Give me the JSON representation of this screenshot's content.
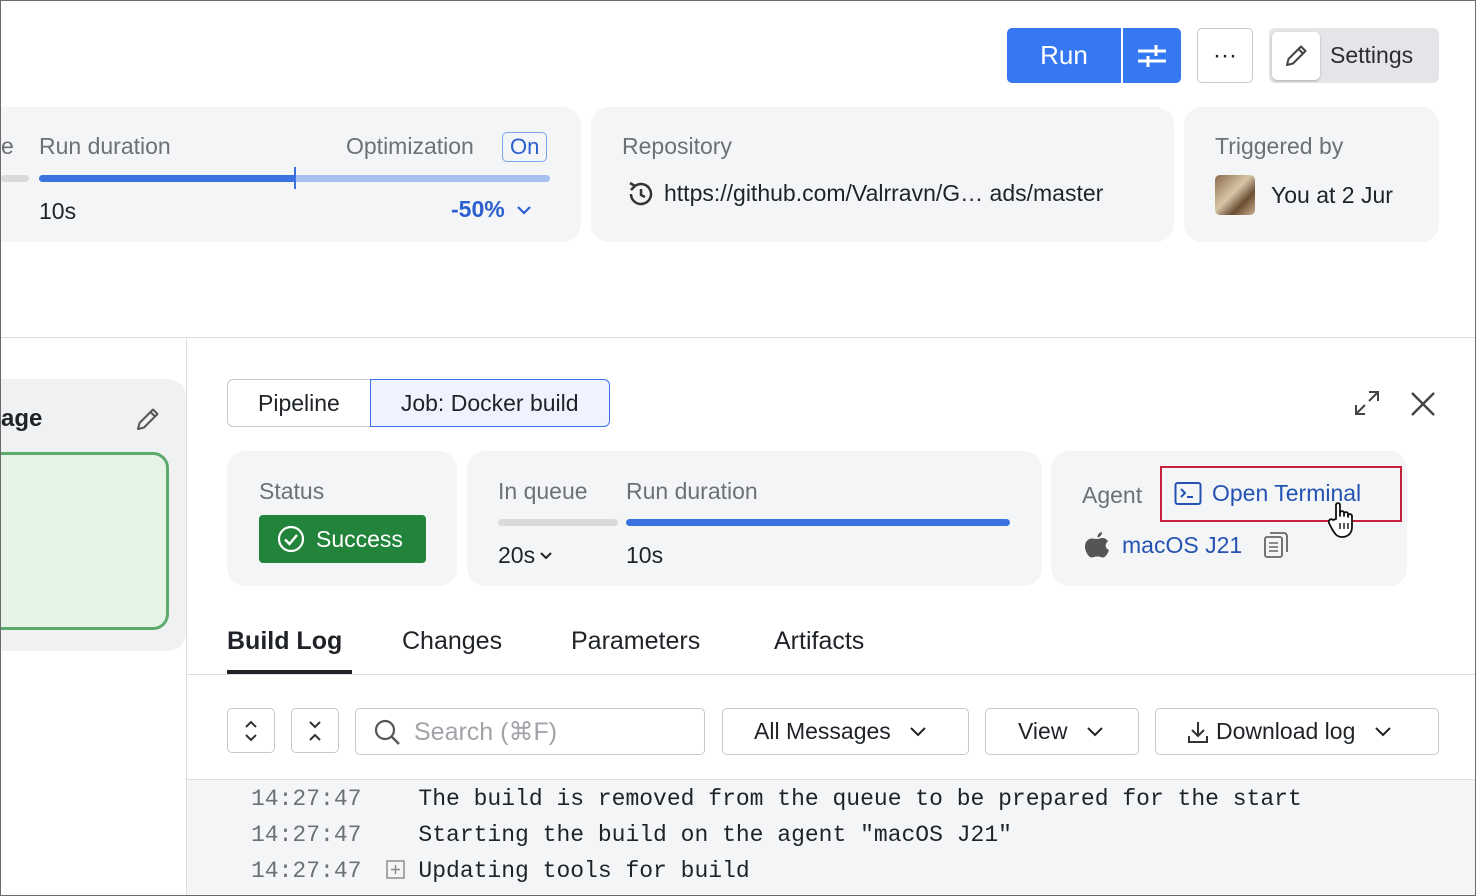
{
  "header": {
    "run_label": "Run",
    "more_label": "···",
    "settings_label": "Settings"
  },
  "summary": {
    "run_duration_label": "Run duration",
    "run_duration_value": "10s",
    "optimization_label": "Optimization",
    "optimization_badge": "On",
    "optimization_percent": "-50%",
    "left_fragment": "e",
    "repository_label": "Repository",
    "repository_value": "https://github.com/Valrravn/G… ads/master",
    "triggered_label": "Triggered by",
    "triggered_value": "You at 2 Jur"
  },
  "left_panel": {
    "title_fragment": "age"
  },
  "job_tabs": {
    "pipeline": "Pipeline",
    "job": "Job: Docker build"
  },
  "job": {
    "status_label": "Status",
    "status_value": "Success",
    "in_queue_label": "In queue",
    "in_queue_value": "20s",
    "run_duration_label": "Run duration",
    "run_duration_value": "10s",
    "agent_label": "Agent",
    "open_terminal": "Open Terminal",
    "agent_name": "macOS J21"
  },
  "tabs": [
    "Build Log",
    "Changes",
    "Parameters",
    "Artifacts"
  ],
  "toolbar": {
    "search_placeholder": "Search (⌘F)",
    "all_messages": "All Messages",
    "view": "View",
    "download_log": "Download log"
  },
  "log": [
    {
      "time": "14:27:47",
      "text": "The build is removed from the queue to be prepared for the start"
    },
    {
      "time": "14:27:47",
      "text": "Starting the build on the agent \"macOS J21\""
    },
    {
      "time": "14:27:47",
      "text": "Updating tools for build"
    }
  ],
  "colors": {
    "accent": "#3578f2",
    "success": "#21843a",
    "link": "#2453b3",
    "highlight": "#c6213a"
  }
}
